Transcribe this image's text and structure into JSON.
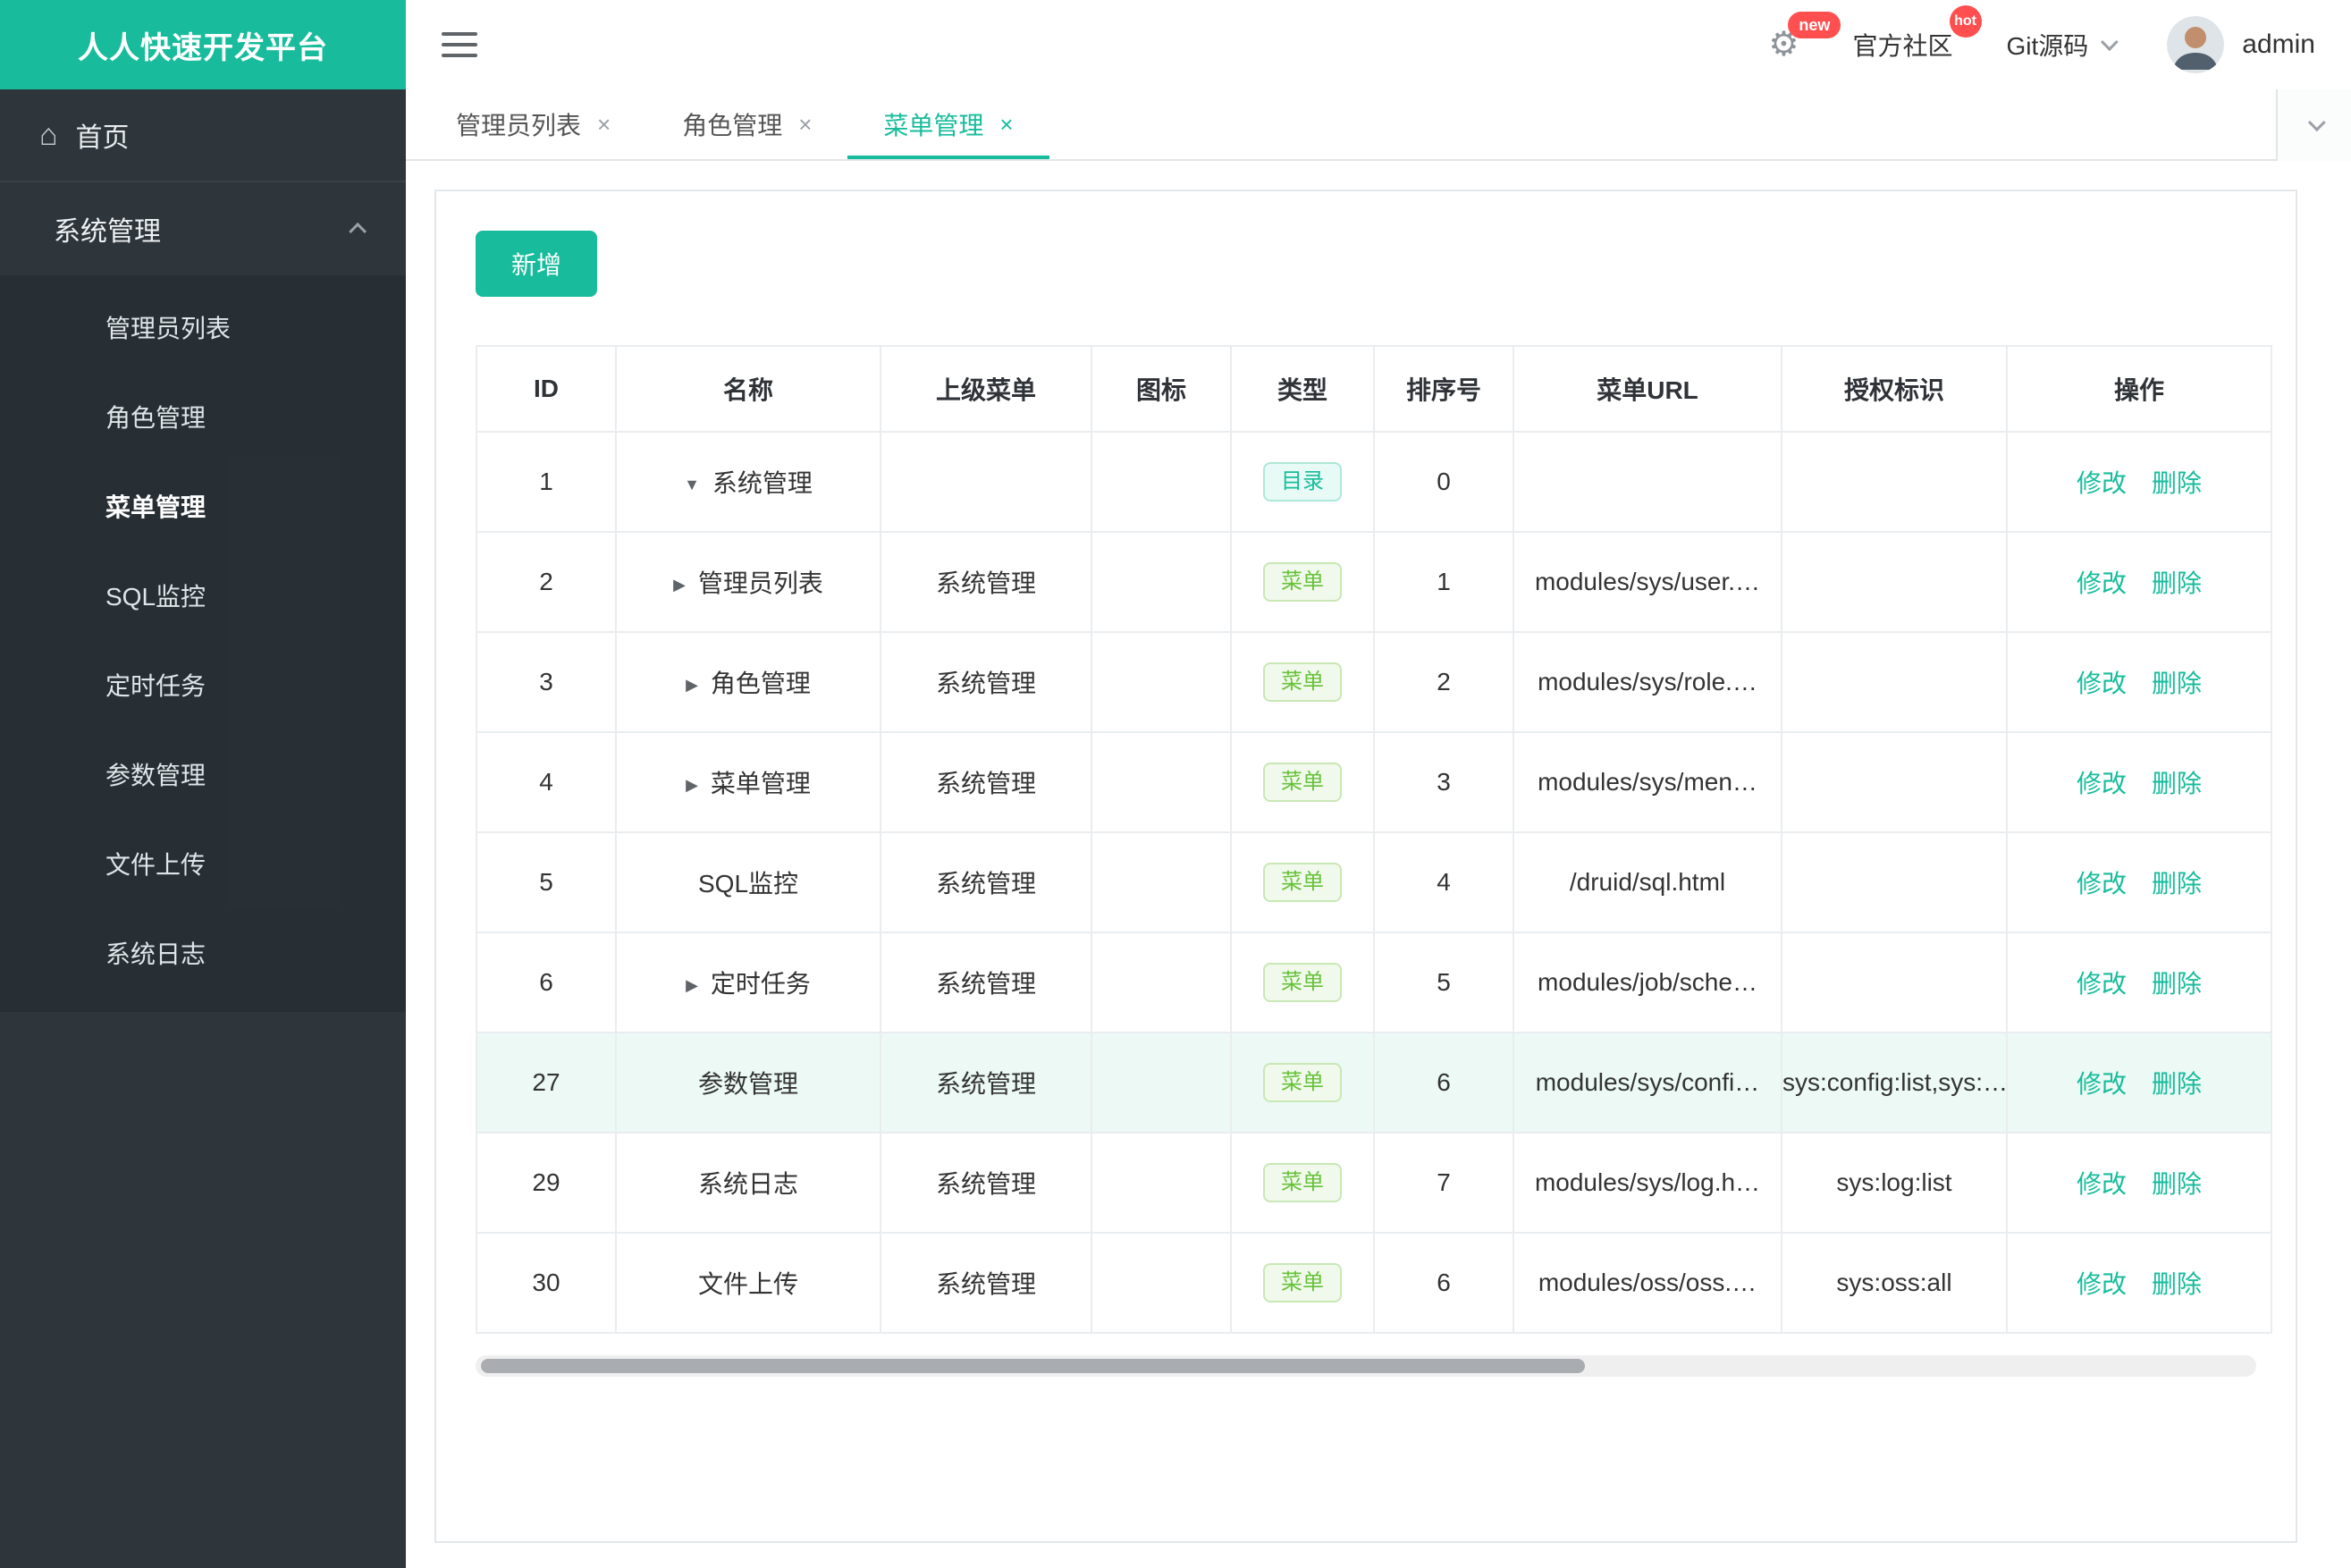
{
  "app": {
    "title": "人人快速开发平台"
  },
  "colors": {
    "brand": "#18bc9c",
    "badge_red": "#ff4f4f",
    "tag_dir_text": "#18bc9c",
    "tag_menu_text": "#67c23a",
    "sidebar_bg": "#2e363c"
  },
  "icons": {
    "close": "×",
    "gear": "⚙",
    "home": "⌂",
    "caret_down": "▼",
    "caret_right": "▶"
  },
  "topbar": {
    "settings_badge": "new",
    "community": "官方社区",
    "community_badge": "hot",
    "git": "Git源码",
    "username": "admin"
  },
  "sidebar": {
    "home_label": "首页",
    "group": {
      "label": "系统管理",
      "expanded": true,
      "active_item": "菜单管理",
      "items": [
        "管理员列表",
        "角色管理",
        "菜单管理",
        "SQL监控",
        "定时任务",
        "参数管理",
        "文件上传",
        "系统日志"
      ]
    }
  },
  "tabs": [
    {
      "label": "管理员列表",
      "active": false
    },
    {
      "label": "角色管理",
      "active": false
    },
    {
      "label": "菜单管理",
      "active": true
    }
  ],
  "toolbar": {
    "add_button": "新增"
  },
  "table": {
    "columns": [
      "ID",
      "名称",
      "上级菜单",
      "图标",
      "类型",
      "排序号",
      "菜单URL",
      "授权标识",
      "操作"
    ],
    "actions": {
      "edit": "修改",
      "delete": "删除"
    },
    "rows": [
      {
        "id": "1",
        "caret": "down",
        "name": "系统管理",
        "parent": "",
        "icon": "",
        "type": "目录",
        "type_kind": "dir",
        "order": "0",
        "url": "",
        "perms": "",
        "highlight": false
      },
      {
        "id": "2",
        "caret": "right",
        "name": "管理员列表",
        "parent": "系统管理",
        "icon": "",
        "type": "菜单",
        "type_kind": "menu",
        "order": "1",
        "url": "modules/sys/user.…",
        "perms": "",
        "highlight": false
      },
      {
        "id": "3",
        "caret": "right",
        "name": "角色管理",
        "parent": "系统管理",
        "icon": "",
        "type": "菜单",
        "type_kind": "menu",
        "order": "2",
        "url": "modules/sys/role.…",
        "perms": "",
        "highlight": false
      },
      {
        "id": "4",
        "caret": "right",
        "name": "菜单管理",
        "parent": "系统管理",
        "icon": "",
        "type": "菜单",
        "type_kind": "menu",
        "order": "3",
        "url": "modules/sys/men…",
        "perms": "",
        "highlight": false
      },
      {
        "id": "5",
        "caret": "none",
        "name": "SQL监控",
        "parent": "系统管理",
        "icon": "",
        "type": "菜单",
        "type_kind": "menu",
        "order": "4",
        "url": "/druid/sql.html",
        "perms": "",
        "highlight": false
      },
      {
        "id": "6",
        "caret": "right",
        "name": "定时任务",
        "parent": "系统管理",
        "icon": "",
        "type": "菜单",
        "type_kind": "menu",
        "order": "5",
        "url": "modules/job/sche…",
        "perms": "",
        "highlight": false
      },
      {
        "id": "27",
        "caret": "none",
        "name": "参数管理",
        "parent": "系统管理",
        "icon": "",
        "type": "菜单",
        "type_kind": "menu",
        "order": "6",
        "url": "modules/sys/confi…",
        "perms": "sys:config:list,sys:…",
        "highlight": true
      },
      {
        "id": "29",
        "caret": "none",
        "name": "系统日志",
        "parent": "系统管理",
        "icon": "",
        "type": "菜单",
        "type_kind": "menu",
        "order": "7",
        "url": "modules/sys/log.h…",
        "perms": "sys:log:list",
        "highlight": false
      },
      {
        "id": "30",
        "caret": "none",
        "name": "文件上传",
        "parent": "系统管理",
        "icon": "",
        "type": "菜单",
        "type_kind": "menu",
        "order": "6",
        "url": "modules/oss/oss.…",
        "perms": "sys:oss:all",
        "highlight": false
      }
    ]
  }
}
